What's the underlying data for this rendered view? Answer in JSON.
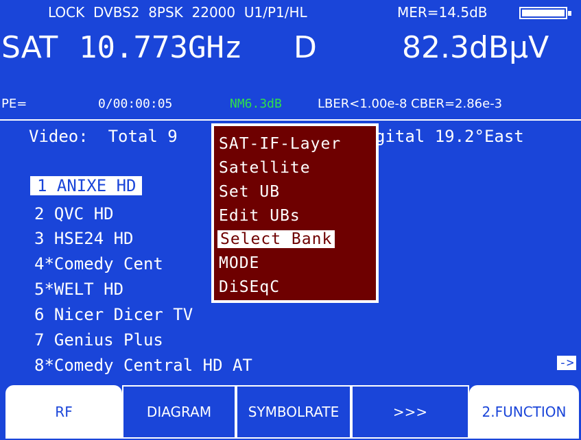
{
  "status": {
    "text": "LOCK  DVBS2  8PSK  22000  U1/P1/HL",
    "mer": "MER=14.5dB",
    "battery_icon": "battery-full-icon"
  },
  "freq": {
    "band": "SAT",
    "value": "10.773GHz",
    "polarization": "D",
    "level": "82.3dBµV"
  },
  "errors": {
    "pe_label": "PE=",
    "time": "0/00:00:05",
    "nm": "NM6.3dB",
    "ber": "LBER<1.00e-8 CBER=2.86e-3",
    "nm_color": "#2ee04a"
  },
  "video": {
    "left": "Video:  Total 9",
    "right": "gital 19.2°East"
  },
  "channels": [
    "1 ANIXE HD",
    "2 QVC HD",
    "3 HSE24 HD",
    "4*Comedy Cent",
    "5*WELT HD",
    "6 Nicer Dicer TV",
    "7 Genius Plus",
    "8*Comedy Central HD AT"
  ],
  "arrow": "->",
  "menu": {
    "items": [
      "SAT-IF-Layer",
      "Satellite",
      "Set UB",
      "Edit UBs",
      "Select Bank",
      "MODE",
      "DiSEqC"
    ],
    "selected": "Select Bank"
  },
  "softkeys": [
    "RF",
    "DIAGRAM",
    "SYMBOLRATE",
    ">>>",
    "2.FUNCTION"
  ],
  "colors": {
    "background": "#1a45d9",
    "menu_bg": "#6e0000",
    "text": "#ffffff"
  }
}
